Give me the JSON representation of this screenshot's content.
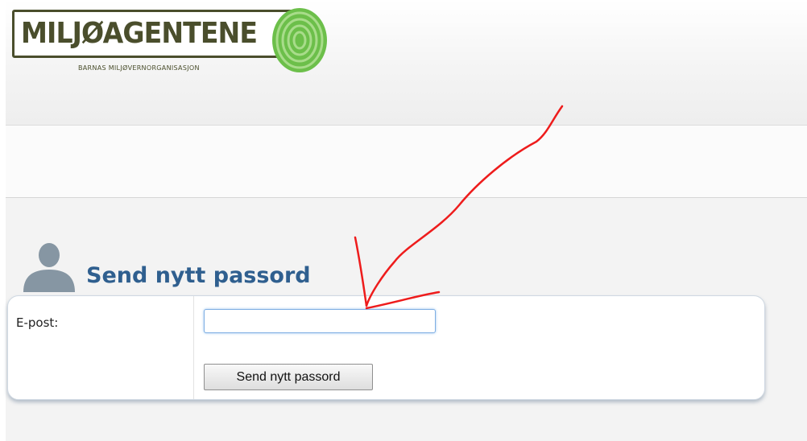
{
  "logo": {
    "title": "MILJØAGENTENE",
    "subtitle": "BARNAS MILJØVERNORGANISASJON"
  },
  "form": {
    "title": "Send nytt passord",
    "email_label": "E-post:",
    "email_value": "",
    "submit_label": "Send nytt passord"
  },
  "icons": {
    "user": "user-silhouette-icon",
    "annotation": "red-arrow-annotation"
  },
  "colors": {
    "title": "#2f5f8f",
    "logo": "#4a4e2c",
    "logo_accent": "#6cbf4a",
    "annotation": "#ee1c1c"
  }
}
